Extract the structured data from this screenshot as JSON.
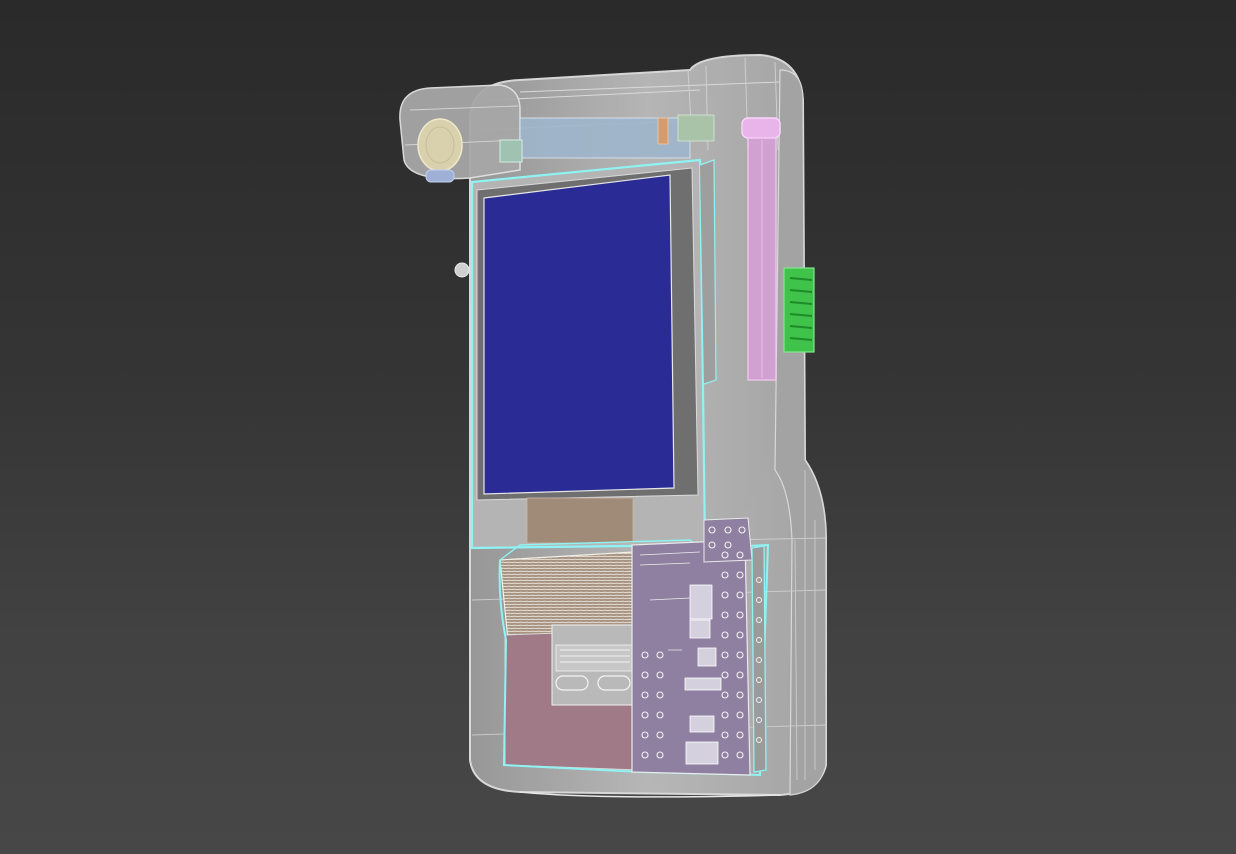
{
  "viewport": {
    "background_top": "#2a2a2a",
    "background_bottom": "#474747"
  },
  "model": {
    "body_color": "#b9b9b9",
    "edge_color": "#e6e6e6",
    "highlight_color": "#8ff3f3",
    "screen_color": "#2b2b96",
    "screen_bezel_color": "#6f6f6f",
    "ribbon_color": "#a08a78",
    "pcb_color": "#8f7fa0",
    "lower_panel_color": "#a07a86",
    "button_color": "#dcd1b0",
    "tube_color": "#e3a6e3",
    "connector_color": "#3fc34b"
  }
}
